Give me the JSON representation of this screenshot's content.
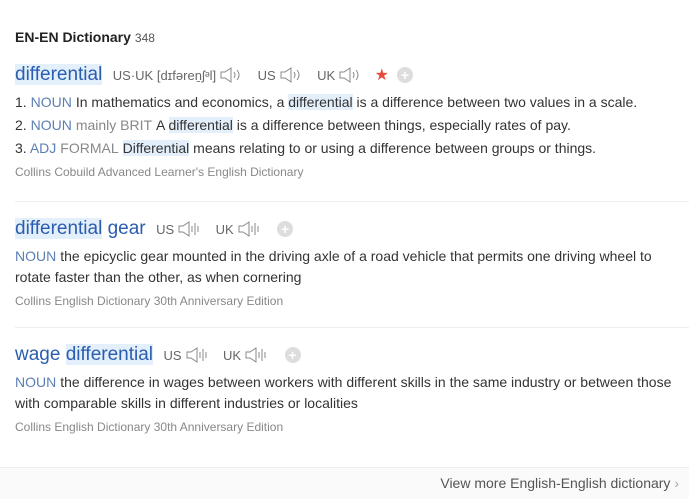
{
  "header": {
    "title": "EN-EN Dictionary",
    "count": "348"
  },
  "entries": [
    {
      "word_hl": "differential",
      "word_rest": "",
      "phonetics": [
        {
          "label": "US·UK [dɪfəreṉʃᵊl]"
        },
        {
          "label": "US"
        },
        {
          "label": "UK"
        }
      ],
      "starred": true,
      "senses": [
        {
          "num": "1.",
          "pos": "NOUN",
          "labels": "",
          "pre": "In mathematics and economics, a ",
          "hl": "differential",
          "post": " is a difference between two values in a scale."
        },
        {
          "num": "2.",
          "pos": "NOUN",
          "labels": "mainly BRIT",
          "pre": "A ",
          "hl": "differential",
          "post": " is a difference between things, especially rates of pay."
        },
        {
          "num": "3.",
          "pos": "ADJ",
          "labels": "FORMAL",
          "pre": "",
          "hl": "Differential",
          "post": " means relating to or using a difference between groups or things."
        }
      ],
      "source": "Collins Cobuild Advanced Learner's English Dictionary"
    },
    {
      "word_hl": "differential",
      "word_rest": " gear",
      "phonetics": [
        {
          "label": "US"
        },
        {
          "label": "UK"
        }
      ],
      "senses": [
        {
          "pos": "NOUN",
          "text": "the epicyclic gear mounted in the driving axle of a road vehicle that permits one driving wheel to rotate faster than the other, as when cornering"
        }
      ],
      "source": "Collins English Dictionary 30th Anniversary Edition"
    },
    {
      "word_pre": "wage ",
      "word_hl": "differential",
      "phonetics": [
        {
          "label": "US"
        },
        {
          "label": "UK"
        }
      ],
      "senses": [
        {
          "pos": "NOUN",
          "text": "the difference in wages between workers with different skills in the same industry or between those with comparable skills in different industries or localities"
        }
      ],
      "source": "Collins English Dictionary 30th Anniversary Edition"
    }
  ],
  "footer": {
    "more_label": "View more English-English dictionary",
    "chevron": "›"
  },
  "colors": {
    "accent": "#2a5db0",
    "highlight": "#e3effb",
    "star": "#e54c3c"
  }
}
